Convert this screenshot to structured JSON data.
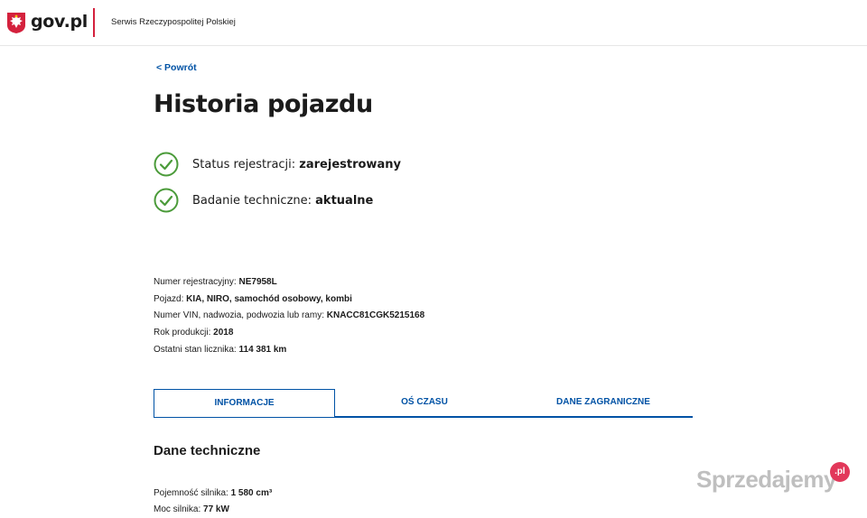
{
  "header": {
    "logo_text": "gov.pl",
    "subtitle": "Serwis Rzeczypospolitej Polskiej"
  },
  "back_link": "< Powrót",
  "page_title": "Historia pojazdu",
  "status": [
    {
      "label": "Status rejestracji:",
      "value": "zarejestrowany",
      "icon": "check-circle-icon"
    },
    {
      "label": "Badanie techniczne:",
      "value": "aktualne",
      "icon": "check-circle-icon"
    }
  ],
  "vehicle_info": [
    {
      "label": "Numer rejestracyjny:",
      "value": "NE7958L"
    },
    {
      "label": "Pojazd:",
      "value": "KIA, NIRO, samochód osobowy, kombi"
    },
    {
      "label": "Numer VIN, nadwozia, podwozia lub ramy:",
      "value": "KNACC81CGK5215168"
    },
    {
      "label": "Rok produkcji:",
      "value": "2018"
    },
    {
      "label": "Ostatni stan licznika:",
      "value": "114 381 km"
    }
  ],
  "tabs": [
    {
      "label": "INFORMACJE",
      "active": true
    },
    {
      "label": "OŚ CZASU",
      "active": false
    },
    {
      "label": "DANE ZAGRANICZNE",
      "active": false
    }
  ],
  "section_title": "Dane techniczne",
  "tech_info": [
    {
      "label": "Pojemność silnika:",
      "value": "1 580 cm³"
    },
    {
      "label": "Moc silnika:",
      "value": "77 kW"
    }
  ],
  "watermark": {
    "text": "Sprzedajemy",
    "badge": ".pl"
  },
  "colors": {
    "accent": "#0052a5",
    "brand_red": "#d4213d",
    "check_green": "#4b9b3a",
    "text": "#1b1b1b"
  }
}
